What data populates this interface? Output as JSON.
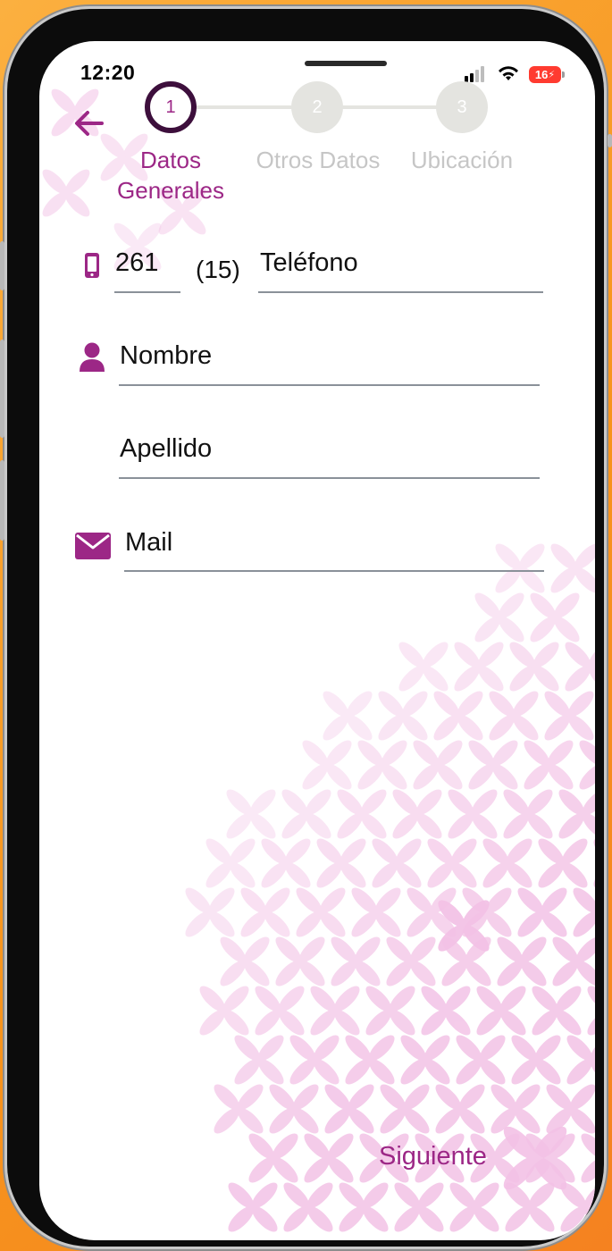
{
  "status_bar": {
    "time": "12:20",
    "battery": "16",
    "icons": [
      "cellular-signal-icon",
      "wifi-icon",
      "battery-charging-icon"
    ]
  },
  "nav": {
    "back_icon": "arrow-left-icon"
  },
  "stepper": {
    "steps": [
      {
        "number": "1",
        "label": "Datos Generales",
        "state": "active"
      },
      {
        "number": "2",
        "label": "Otros Datos",
        "state": "inactive"
      },
      {
        "number": "3",
        "label": "Ubicación",
        "state": "inactive"
      }
    ]
  },
  "form": {
    "phone": {
      "icon": "mobile-phone-icon",
      "area_code": "261",
      "prefix": "(15)",
      "placeholder": "Teléfono"
    },
    "name": {
      "icon": "user-icon",
      "placeholder": "Nombre"
    },
    "surname": {
      "placeholder": "Apellido"
    },
    "email": {
      "icon": "envelope-icon",
      "placeholder": "Mail"
    }
  },
  "actions": {
    "next_label": "Siguiente"
  },
  "colors": {
    "primary": "#9c2786",
    "step_active_ring": "#3d0f3c",
    "step_inactive": "#e4e4e0",
    "underline": "#8a9199",
    "petal": "#f3c2e6",
    "background_outer": "#f7941d"
  }
}
